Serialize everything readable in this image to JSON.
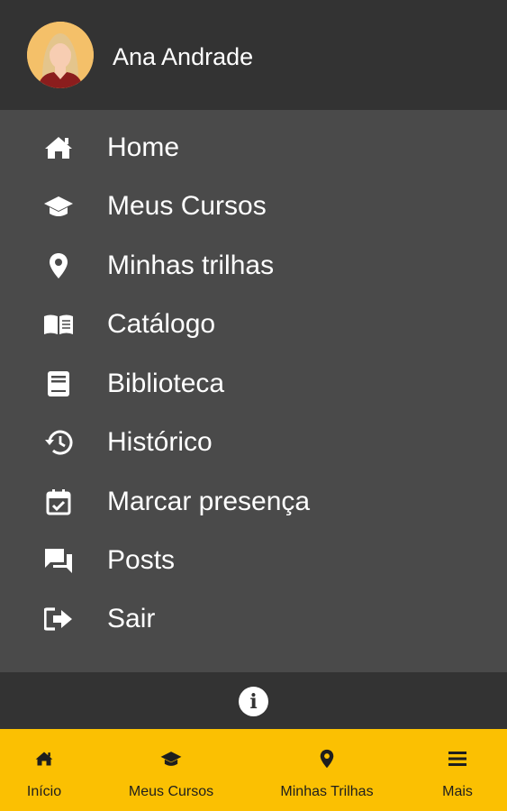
{
  "header": {
    "user_name": "Ana Andrade",
    "avatar_icon": "user-avatar"
  },
  "menu": {
    "items": [
      {
        "label": "Home",
        "icon": "home-icon"
      },
      {
        "label": "Meus Cursos",
        "icon": "graduation-cap-icon"
      },
      {
        "label": "Minhas trilhas",
        "icon": "map-pin-icon"
      },
      {
        "label": "Catálogo",
        "icon": "open-book-icon"
      },
      {
        "label": "Biblioteca",
        "icon": "book-icon"
      },
      {
        "label": "Histórico",
        "icon": "history-icon"
      },
      {
        "label": "Marcar presença",
        "icon": "calendar-check-icon"
      },
      {
        "label": "Posts",
        "icon": "forum-icon"
      },
      {
        "label": "Sair",
        "icon": "sign-out-icon"
      }
    ]
  },
  "info": {
    "icon": "info-icon"
  },
  "bottom_nav": {
    "items": [
      {
        "label": "Início",
        "icon": "home-icon"
      },
      {
        "label": "Meus Cursos",
        "icon": "graduation-cap-icon"
      },
      {
        "label": "Minhas Trilhas",
        "icon": "map-pin-icon"
      },
      {
        "label": "Mais",
        "icon": "menu-icon"
      }
    ]
  },
  "colors": {
    "header_bg": "#333333",
    "menu_bg": "#4a4a4a",
    "accent": "#fbc002",
    "text": "#ffffff"
  }
}
